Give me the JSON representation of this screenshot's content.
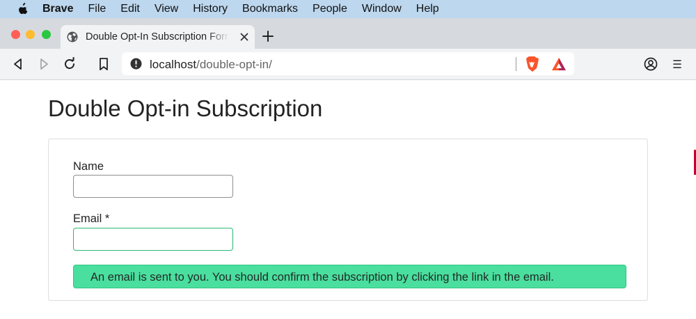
{
  "menubar": {
    "app_name": "Brave",
    "items": [
      "File",
      "Edit",
      "View",
      "History",
      "Bookmarks",
      "People",
      "Window",
      "Help"
    ]
  },
  "tab": {
    "title": "Double Opt-In Subscription Form",
    "icon": "globe-icon"
  },
  "toolbar": {
    "url_host": "localhost",
    "url_path": "/double-opt-in/",
    "icons": [
      "back-icon",
      "forward-icon",
      "reload-icon",
      "bookmark-icon",
      "info-icon",
      "brave-shields-icon",
      "brave-rewards-icon",
      "profile-icon",
      "menu-icon"
    ]
  },
  "page": {
    "title": "Double Opt-in Subscription",
    "form": {
      "name_label": "Name",
      "name_value": "",
      "email_label": "Email *",
      "email_value": ""
    },
    "alert_message": "An email is sent to you. You should confirm the subscription by clicking the link in the email."
  },
  "colors": {
    "menubar_bg": "#bcd7ee",
    "alert_bg": "#4ade9f",
    "valid_border": "#2bb673",
    "brave_orange": "#fb542b"
  }
}
